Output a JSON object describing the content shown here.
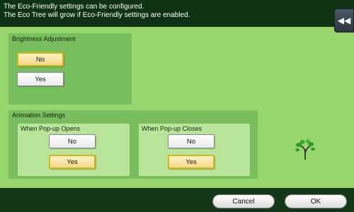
{
  "header": {
    "line1": "The Eco-Friendly settings can be configured.",
    "line2": "The Eco Tree will grow if Eco-Friendly settings are enabled.",
    "back_icon": "double-chevron-left-icon"
  },
  "brightness": {
    "title": "Brightness Adjustment",
    "options": [
      "No",
      "Yes"
    ],
    "selected": "No"
  },
  "animation": {
    "title": "Animation Settings",
    "opens": {
      "title": "When Pop-up Opens",
      "options": [
        "No",
        "Yes"
      ],
      "selected": "Yes"
    },
    "closes": {
      "title": "When Pop-up Closes",
      "options": [
        "No",
        "Yes"
      ],
      "selected": "Yes"
    }
  },
  "footer": {
    "cancel": "Cancel",
    "ok": "OK"
  },
  "colors": {
    "background": "#96d66d",
    "header": "#0f3312",
    "selected_border": "#d7b412"
  },
  "icons": {
    "eco_tree": "sprout-icon"
  }
}
